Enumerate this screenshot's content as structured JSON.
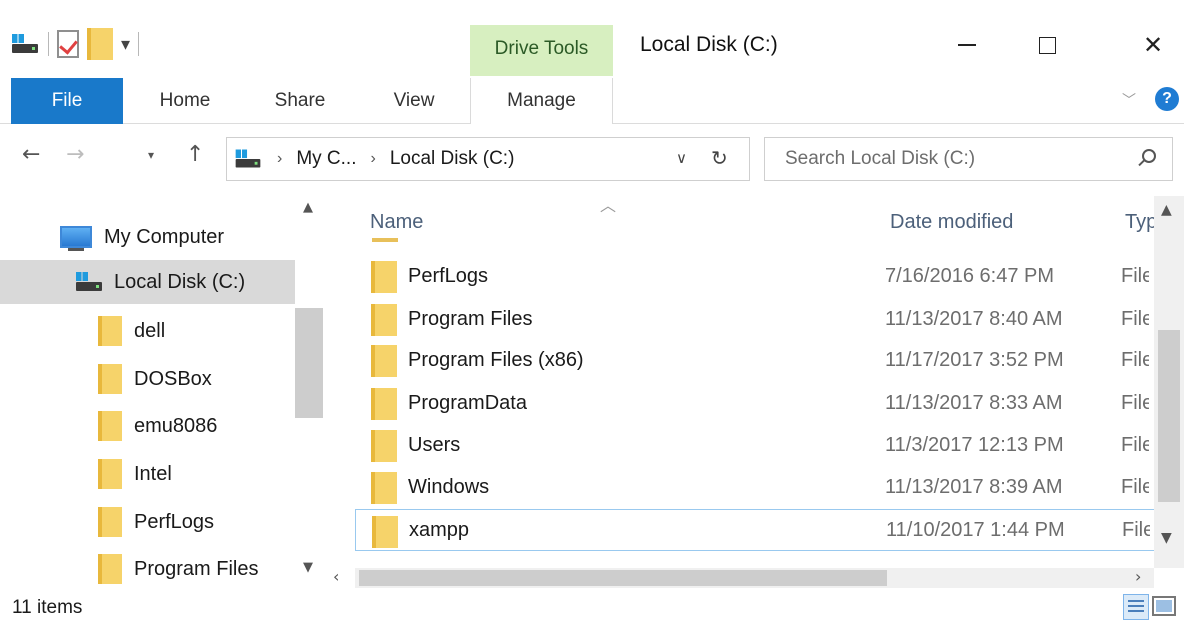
{
  "window": {
    "title": "Local Disk (C:)",
    "context_tab_label": "Drive Tools",
    "minimize_label": "",
    "maximize_label": "",
    "close_label": "✕"
  },
  "ribbon": {
    "tabs": [
      "File",
      "Home",
      "Share",
      "View",
      "Manage"
    ],
    "help_label": "?"
  },
  "address": {
    "breadcrumb": [
      "My C...",
      "Local Disk (C:)"
    ],
    "search_placeholder": "Search Local Disk (C:)"
  },
  "navigation": {
    "items": [
      {
        "label": "My Computer",
        "icon": "computer-icon",
        "selected": false
      },
      {
        "label": "Local Disk (C:)",
        "icon": "drive-icon",
        "selected": true
      },
      {
        "label": "dell",
        "icon": "folder-icon",
        "selected": false
      },
      {
        "label": "DOSBox",
        "icon": "folder-icon",
        "selected": false
      },
      {
        "label": "emu8086",
        "icon": "folder-icon",
        "selected": false
      },
      {
        "label": "Intel",
        "icon": "folder-icon",
        "selected": false
      },
      {
        "label": "PerfLogs",
        "icon": "folder-icon",
        "selected": false
      },
      {
        "label": "Program Files",
        "icon": "folder-icon",
        "selected": false
      }
    ]
  },
  "file_list": {
    "columns": [
      "Name",
      "Date modified",
      "Typ"
    ],
    "rows": [
      {
        "name": "PerfLogs",
        "date": "7/16/2016 6:47 PM",
        "type": "File"
      },
      {
        "name": "Program Files",
        "date": "11/13/2017 8:40 AM",
        "type": "File"
      },
      {
        "name": "Program Files (x86)",
        "date": "11/17/2017 3:52 PM",
        "type": "File"
      },
      {
        "name": "ProgramData",
        "date": "11/13/2017 8:33 AM",
        "type": "File"
      },
      {
        "name": "Users",
        "date": "11/3/2017 12:13 PM",
        "type": "File"
      },
      {
        "name": "Windows",
        "date": "11/13/2017 8:39 AM",
        "type": "File"
      },
      {
        "name": "xampp",
        "date": "11/10/2017 1:44 PM",
        "type": "File"
      }
    ]
  },
  "status": {
    "item_count": "11 items"
  },
  "colors": {
    "file_tab": "#1979ca",
    "drive_tools": "#d7efc0",
    "selection": "#d9d9d9",
    "folder": "#f6d36a"
  }
}
